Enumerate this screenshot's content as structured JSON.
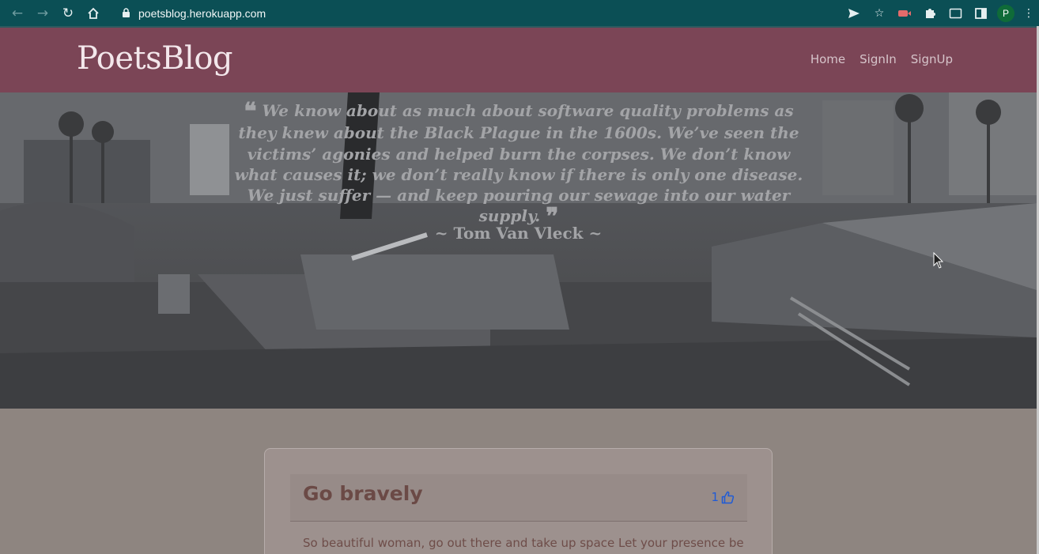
{
  "browser": {
    "url": "poetsblog.herokuapp.com",
    "profile_initial": "P"
  },
  "site": {
    "brand": "PoetsBlog",
    "nav": [
      "Home",
      "SignIn",
      "SignUp"
    ]
  },
  "hero": {
    "quote": "We know about as much about software quality problems as they knew about the Black Plague in the 1600s. We’ve seen the victims’ agonies and helped burn the corpses. We don’t know what causes it; we don’t really know if there is only one disease. We just suffer — and keep pouring our sewage into our water supply.",
    "author": "~ Tom Van Vleck ~"
  },
  "post": {
    "title": "Go bravely",
    "likes": "1",
    "excerpt": "So beautiful woman, go out there and take up space Let your presence be"
  },
  "colors": {
    "browser_chrome": "#0b4f55",
    "header": "#7b4556",
    "page_bg": "#8e8580",
    "like_blue": "#1f5bd6"
  }
}
